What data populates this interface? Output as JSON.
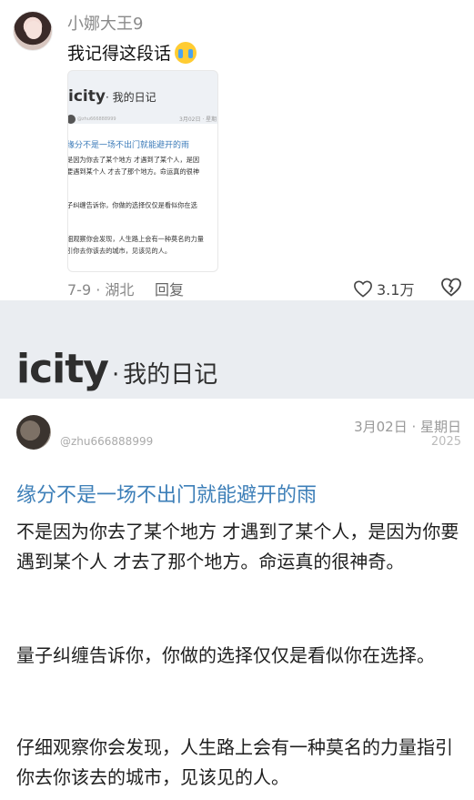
{
  "comment": {
    "username": "小娜大王9",
    "text": "我记得这段话",
    "emoji": "crying-face",
    "thumbnail": {
      "brand": "icity",
      "brand_sub": "· 我的日记",
      "user": "@zhu666888999",
      "date": "3月02日 · 星期",
      "title": "缘分不是一场不出门就能避开的雨",
      "lines": [
        "是因为你去了某个地方 才遇到了某个人，是因",
        "要遇到某个人 才去了那个地方。命运真的很神",
        "子纠缠告诉你，你做的选择仅仅是看似你在选",
        "细观察你会发现，人生路上会有一种莫名的力量",
        "引你去你该去的城市，见该见的人。"
      ]
    },
    "date_location": "7-9 · 湖北",
    "reply_label": "回复",
    "like_count": "3.1万"
  },
  "post": {
    "brand": "icity",
    "brand_sep": "·",
    "brand_sub": "我的日记",
    "user": "@zhu666888999",
    "date": "3月02日 · 星期日",
    "year": "2025",
    "title": "缘分不是一场不出门就能避开的雨",
    "paragraphs": [
      "不是因为你去了某个地方 才遇到了某个人，是因为你要遇到某个人 才去了那个地方。命运真的很神奇。",
      "量子纠缠告诉你，你做的选择仅仅是看似你在选择。",
      "仔细观察你会发现，人生路上会有一种莫名的力量指引你去你该去的城市，见该见的人。"
    ]
  },
  "colors": {
    "title_blue": "#3d7fb8",
    "meta_gray": "#888888",
    "panel_bg": "#eaedf1"
  }
}
